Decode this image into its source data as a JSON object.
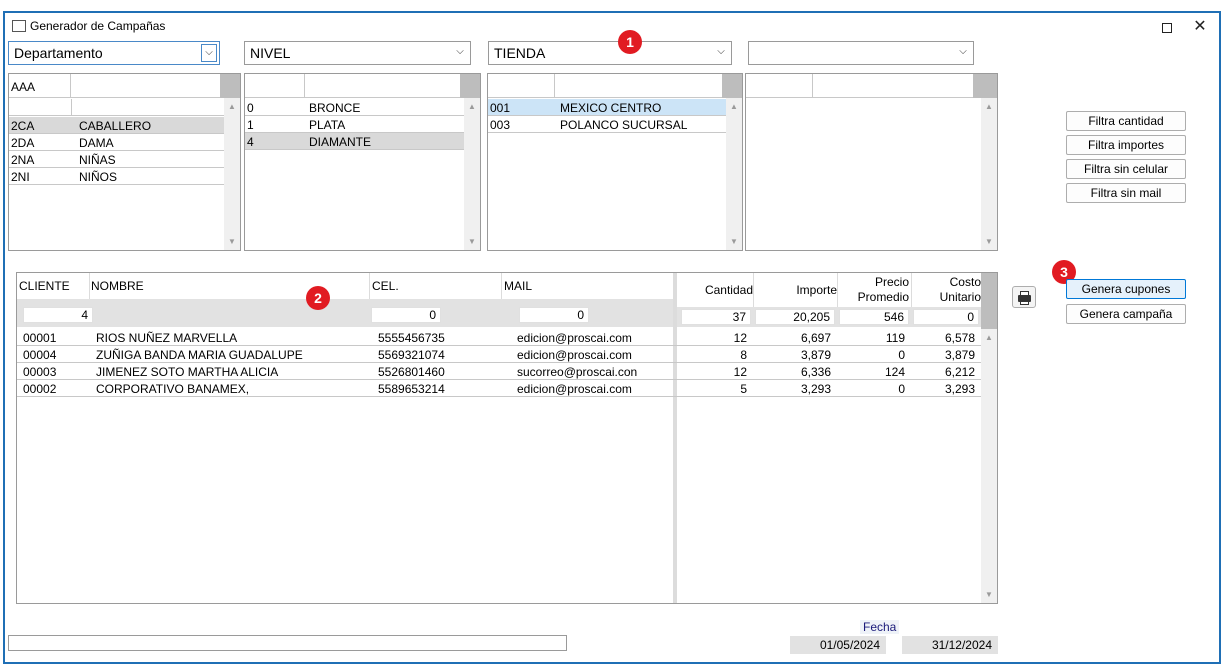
{
  "window": {
    "title": "Generador de Campañas",
    "maximize_glyph": "",
    "close_glyph": "✕"
  },
  "dropdowns": [
    {
      "value": "Departamento"
    },
    {
      "value": "NIVEL"
    },
    {
      "value": "TIENDA"
    },
    {
      "value": ""
    }
  ],
  "dropdown_arrow": "⌵",
  "list_departamento": {
    "header": "AAA",
    "rows": [
      {
        "code": "2CA",
        "name": "CABALLERO"
      },
      {
        "code": "2DA",
        "name": "DAMA"
      },
      {
        "code": "2NA",
        "name": "NIÑAS"
      },
      {
        "code": "2NI",
        "name": "NIÑOS"
      }
    ]
  },
  "list_nivel": {
    "rows": [
      {
        "code": "0",
        "name": "BRONCE"
      },
      {
        "code": "1",
        "name": "PLATA"
      },
      {
        "code": "4",
        "name": "DIAMANTE"
      }
    ]
  },
  "list_tienda": {
    "rows": [
      {
        "code": "001",
        "name": "MEXICO CENTRO"
      },
      {
        "code": "003",
        "name": "POLANCO SUCURSAL"
      }
    ]
  },
  "side_buttons": {
    "filtra_cantidad": "Filtra cantidad",
    "filtra_importes": "Filtra importes",
    "filtra_sin_celular": "Filtra sin celular",
    "filtra_sin_mail": "Filtra sin mail",
    "genera_cupones": "Genera cupones",
    "genera_campana": "Genera campaña"
  },
  "grid": {
    "headers": {
      "cliente": "CLIENTE",
      "nombre": "NOMBRE",
      "cel": "CEL.",
      "mail": "MAIL",
      "cantidad": "Cantidad",
      "importe": "Importe",
      "precio_l1": "Precio",
      "precio_l2": "Promedio",
      "costo_l1": "Costo",
      "costo_l2": "Unitario"
    },
    "totals": {
      "cliente": "4",
      "cel": "0",
      "mail": "0",
      "cantidad": "37",
      "importe": "20,205",
      "precio": "546",
      "costo": "0"
    },
    "rows": [
      {
        "cliente": "00001",
        "nombre": "RIOS NUÑEZ MARVELLA",
        "cel": "5555456735",
        "mail": "edicion@proscai.com",
        "cantidad": "12",
        "importe": "6,697",
        "precio": "119",
        "costo": "6,578"
      },
      {
        "cliente": "00004",
        "nombre": "ZUÑIGA BANDA MARIA GUADALUPE",
        "cel": "5569321074",
        "mail": "edicion@proscai.com",
        "cantidad": "8",
        "importe": "3,879",
        "precio": "0",
        "costo": "3,879"
      },
      {
        "cliente": "00003",
        "nombre": "JIMENEZ SOTO MARTHA ALICIA",
        "cel": "5526801460",
        "mail": "sucorreo@proscai.con",
        "cantidad": "12",
        "importe": "6,336",
        "precio": "124",
        "costo": "6,212"
      },
      {
        "cliente": "00002",
        "nombre": "CORPORATIVO BANAMEX,",
        "cel": "5589653214",
        "mail": "edicion@proscai.com",
        "cantidad": "5",
        "importe": "3,293",
        "precio": "0",
        "costo": "3,293"
      }
    ]
  },
  "badges": [
    "1",
    "2",
    "3"
  ],
  "fecha": {
    "label": "Fecha",
    "start": "01/05/2024",
    "end": "31/12/2024"
  },
  "scroll_up": "▲",
  "scroll_down": "▼",
  "colors": {
    "badge": "#e11b22",
    "window_border": "#1f6fb5",
    "selected_row_blue": "#cce4f7",
    "selected_row_grey": "#d9d9d9"
  }
}
